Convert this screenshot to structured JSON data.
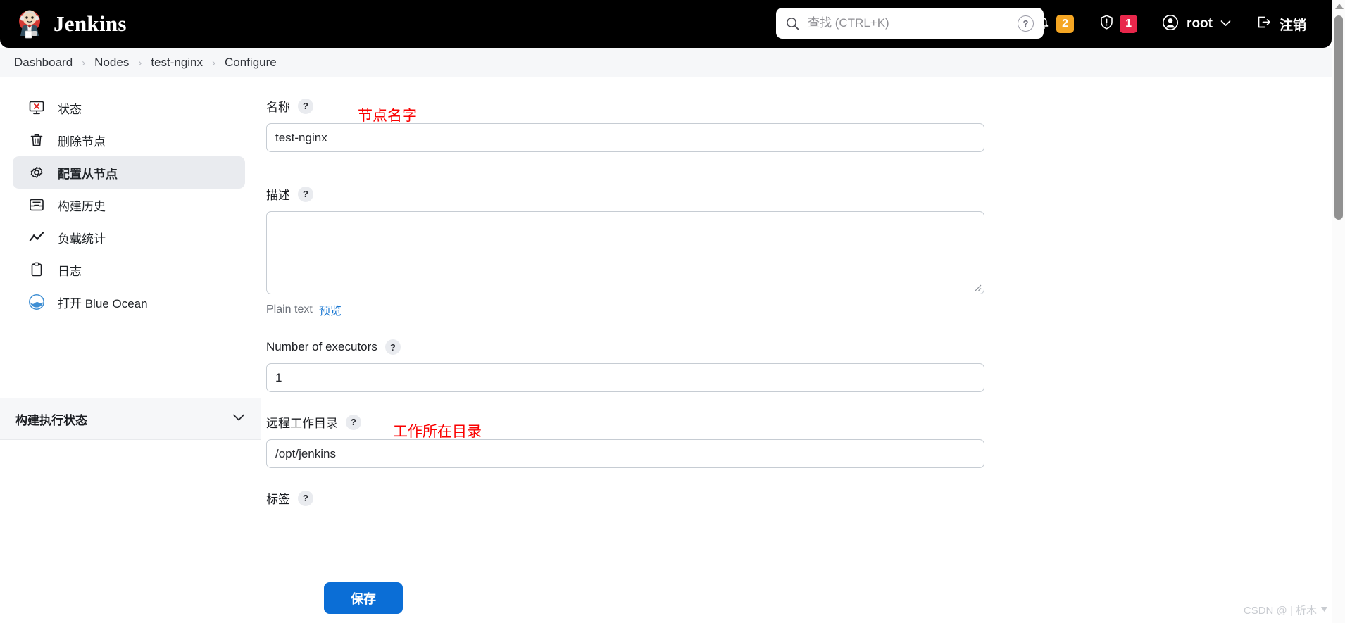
{
  "header": {
    "brand_title": "Jenkins",
    "logo_icon": "jenkins-butler-logo",
    "search": {
      "placeholder": "查找 (CTRL+K)",
      "value": "",
      "icon": "search-icon",
      "help_icon": "question-circle-icon"
    },
    "notifications": {
      "icon": "bell-icon",
      "count": "2",
      "color": "#f5a623"
    },
    "security": {
      "icon": "shield-exclamation-icon",
      "count": "1",
      "color": "#e8274b"
    },
    "user": {
      "icon": "person-circle-icon",
      "name": "root",
      "chevron": "chevron-down-icon"
    },
    "logout": {
      "icon": "logout-icon",
      "label": "注销"
    }
  },
  "breadcrumb": {
    "separator": "›",
    "items": [
      {
        "label": "Dashboard"
      },
      {
        "label": "Nodes"
      },
      {
        "label": "test-nginx"
      },
      {
        "label": "Configure"
      }
    ]
  },
  "sidebar": {
    "items": [
      {
        "label": "状态",
        "icon": "monitor-error-icon"
      },
      {
        "label": "删除节点",
        "icon": "trash-icon"
      },
      {
        "label": "配置从节点",
        "icon": "gear-icon",
        "active": true
      },
      {
        "label": "构建历史",
        "icon": "inbox-icon"
      },
      {
        "label": "负载统计",
        "icon": "trend-line-icon"
      },
      {
        "label": "日志",
        "icon": "clipboard-icon"
      },
      {
        "label": "打开 Blue Ocean",
        "icon": "blue-ocean-icon"
      }
    ],
    "executor_panel": {
      "title": "构建执行状态",
      "chevron": "chevron-down-icon"
    }
  },
  "form": {
    "name_field": {
      "label": "名称",
      "help": "?",
      "value": "test-nginx",
      "annotation": "节点名字"
    },
    "description_field": {
      "label": "描述",
      "help": "?",
      "value": "",
      "plain_text_note": "Plain text",
      "preview_link": "预览"
    },
    "executors_field": {
      "label": "Number of executors",
      "help": "?",
      "value": "1"
    },
    "remote_dir_field": {
      "label": "远程工作目录",
      "help": "?",
      "value": "/opt/jenkins",
      "annotation": "工作所在目录"
    },
    "labels_field": {
      "label": "标签",
      "help": "?"
    },
    "save_button": "保存"
  },
  "watermark": {
    "text": "CSDN @ | 析木"
  }
}
